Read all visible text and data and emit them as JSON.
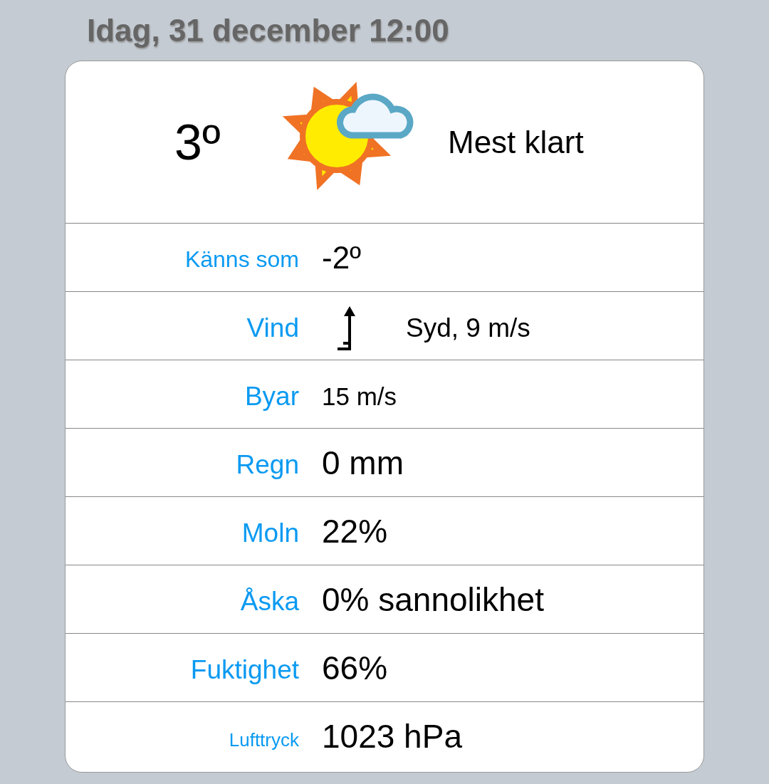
{
  "heading": "Idag, 31 december 12:00",
  "current": {
    "temperature": "3º",
    "condition": "Mest klart"
  },
  "rows": [
    {
      "kind": "plain",
      "label": "Känns som",
      "value": "-2º"
    },
    {
      "kind": "wind",
      "label": "Vind",
      "value": "Syd, 9 m/s"
    },
    {
      "kind": "plain",
      "label": "Byar",
      "value": "15 m/s"
    },
    {
      "kind": "plain",
      "label": "Regn",
      "value": "0 mm"
    },
    {
      "kind": "plain",
      "label": "Moln",
      "value": "22%"
    },
    {
      "kind": "plain",
      "label": "Åska",
      "value": "0% sannolikhet"
    },
    {
      "kind": "plain",
      "label": "Fuktighet",
      "value": "66%"
    },
    {
      "kind": "plain",
      "label": "Lufttryck",
      "value": "1023 hPa"
    }
  ]
}
